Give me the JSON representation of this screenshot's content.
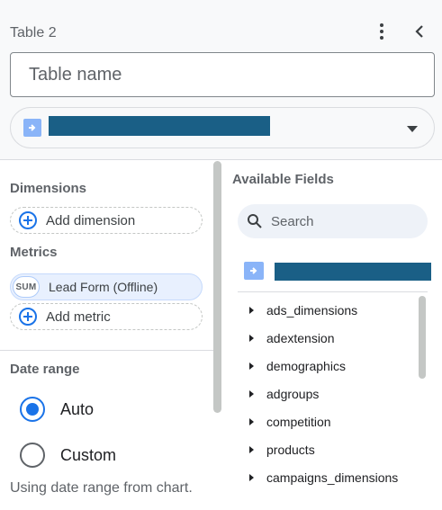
{
  "header": {
    "title": "Table 2",
    "name_placeholder": "Table name",
    "more_icon": "more-vert-icon",
    "collapse_icon": "chevron-left-icon"
  },
  "data_source": {
    "icon": "data-source-icon",
    "caret_icon": "dropdown-caret-icon"
  },
  "setup": {
    "dimensions_label": "Dimensions",
    "add_dimension_label": "Add dimension",
    "metrics_label": "Metrics",
    "metric": {
      "aggregation": "SUM",
      "name": "Lead Form (Offline)"
    },
    "add_metric_label": "Add metric",
    "date_range_label": "Date range",
    "date_options": [
      {
        "label": "Auto",
        "selected": true
      },
      {
        "label": "Custom",
        "selected": false
      }
    ],
    "date_hint": "Using date range from chart."
  },
  "available_fields": {
    "title": "Available Fields",
    "search_placeholder": "Search",
    "groups": [
      "ads_dimensions",
      "adextension",
      "demographics",
      "adgroups",
      "competition",
      "products",
      "campaigns_dimensions"
    ]
  },
  "colors": {
    "accent": "#1a73e8",
    "redacted": "#1a5f86",
    "chip_bg": "#e8f0fe"
  }
}
